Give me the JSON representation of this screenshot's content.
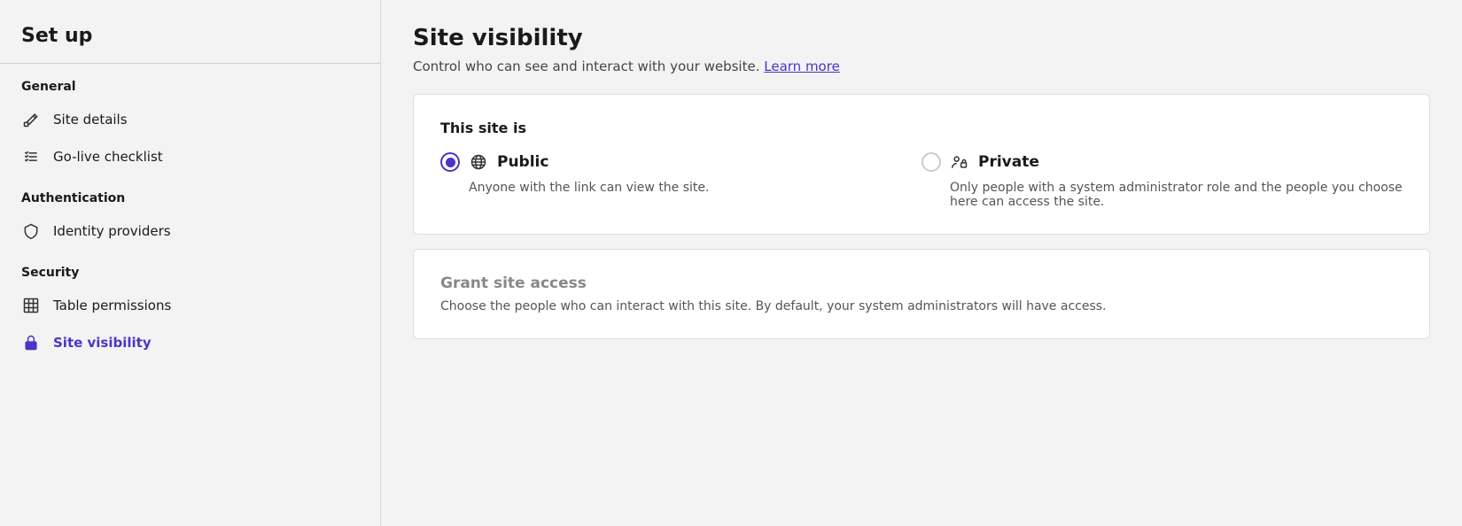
{
  "sidebar": {
    "title": "Set up",
    "sections": [
      {
        "label": "General",
        "items": [
          {
            "id": "site-details",
            "label": "Site details",
            "icon": "edit-icon",
            "active": false
          },
          {
            "id": "go-live-checklist",
            "label": "Go-live checklist",
            "icon": "checklist-icon",
            "active": false
          }
        ]
      },
      {
        "label": "Authentication",
        "items": [
          {
            "id": "identity-providers",
            "label": "Identity providers",
            "icon": "shield-icon",
            "active": false
          }
        ]
      },
      {
        "label": "Security",
        "items": [
          {
            "id": "table-permissions",
            "label": "Table permissions",
            "icon": "table-icon",
            "active": false
          },
          {
            "id": "site-visibility",
            "label": "Site visibility",
            "icon": "lock-icon",
            "active": true
          }
        ]
      }
    ]
  },
  "main": {
    "title": "Site visibility",
    "description": "Control who can see and interact with your website.",
    "learn_more": "Learn more",
    "card1": {
      "section_title": "This site is",
      "options": [
        {
          "id": "public",
          "label": "Public",
          "icon": "globe-icon",
          "selected": true,
          "description": "Anyone with the link can view the site."
        },
        {
          "id": "private",
          "label": "Private",
          "icon": "people-lock-icon",
          "selected": false,
          "description": "Only people with a system administrator role and the people you choose here can access the site."
        }
      ]
    },
    "card2": {
      "title": "Grant site access",
      "description": "Choose the people who can interact with this site. By default, your system administrators will have access."
    }
  },
  "colors": {
    "accent": "#4b35c4",
    "text_primary": "#1a1a1a",
    "text_secondary": "#555",
    "border": "#e0e0e0"
  }
}
